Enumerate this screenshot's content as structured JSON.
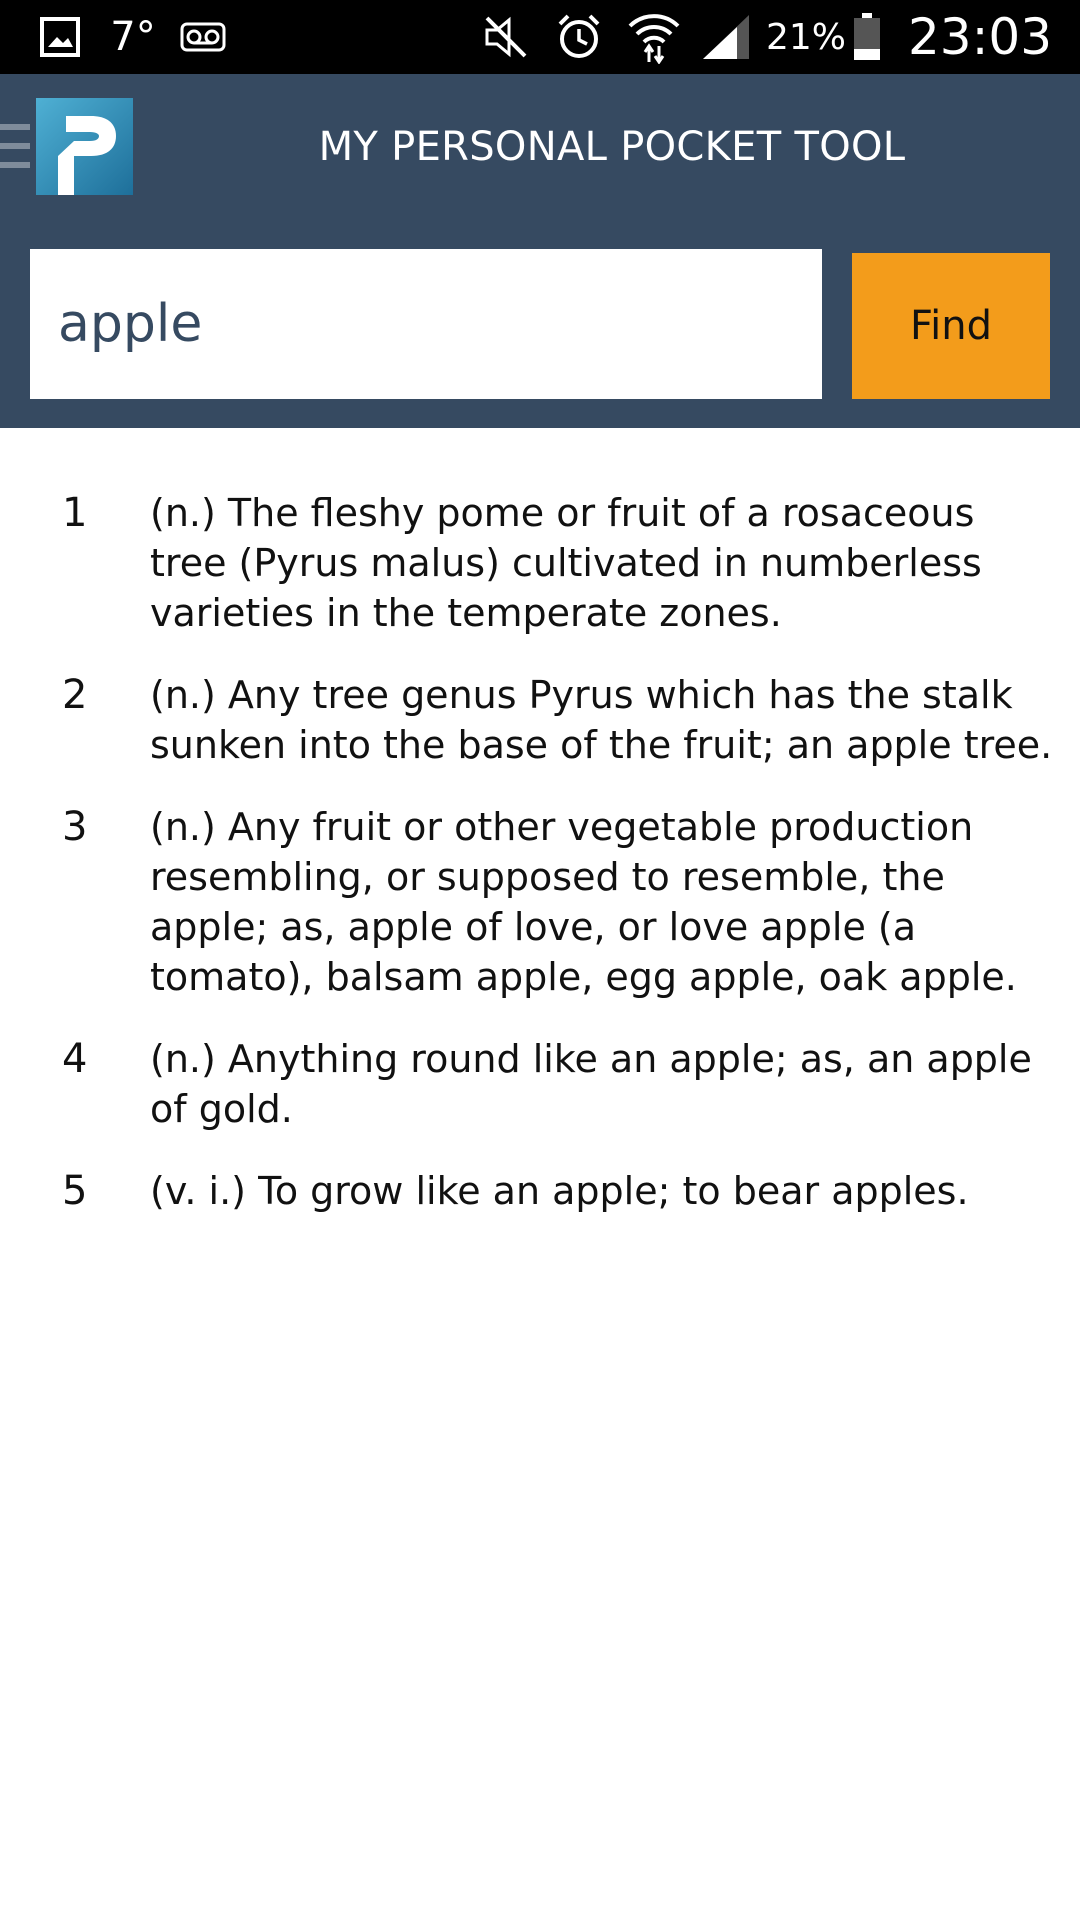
{
  "status_bar": {
    "temperature": "7°",
    "battery_percent": "21%",
    "time": "23:03",
    "icons": [
      "gallery-icon",
      "voicemail-icon",
      "mute-icon",
      "alarm-icon",
      "wifi-icon",
      "signal-icon",
      "battery-icon"
    ]
  },
  "app_bar": {
    "title": "MY PERSONAL POCKET TOOL",
    "logo_letter": "P",
    "colors": {
      "bar": "#364a61",
      "logo_light": "#4fb0d4",
      "logo_dark": "#1e6f9a"
    }
  },
  "search": {
    "value": "apple",
    "find_label": "Find",
    "button_color": "#f39c1b"
  },
  "definitions": [
    {
      "number": "1",
      "text": "(n.) The fleshy pome or fruit of a rosaceous tree (Pyrus malus) cultivated in numberless varieties in the temperate zones."
    },
    {
      "number": "2",
      "text": "(n.) Any tree genus Pyrus which has the stalk sunken into the base of the fruit; an apple tree."
    },
    {
      "number": "3",
      "text": "(n.) Any fruit or other vegetable production resembling, or supposed to resemble, the apple; as, apple of love, or love apple (a tomato), balsam apple, egg apple, oak apple."
    },
    {
      "number": "4",
      "text": "(n.) Anything round like an apple; as, an apple of gold."
    },
    {
      "number": "5",
      "text": "(v. i.) To grow like an apple; to bear apples."
    }
  ]
}
